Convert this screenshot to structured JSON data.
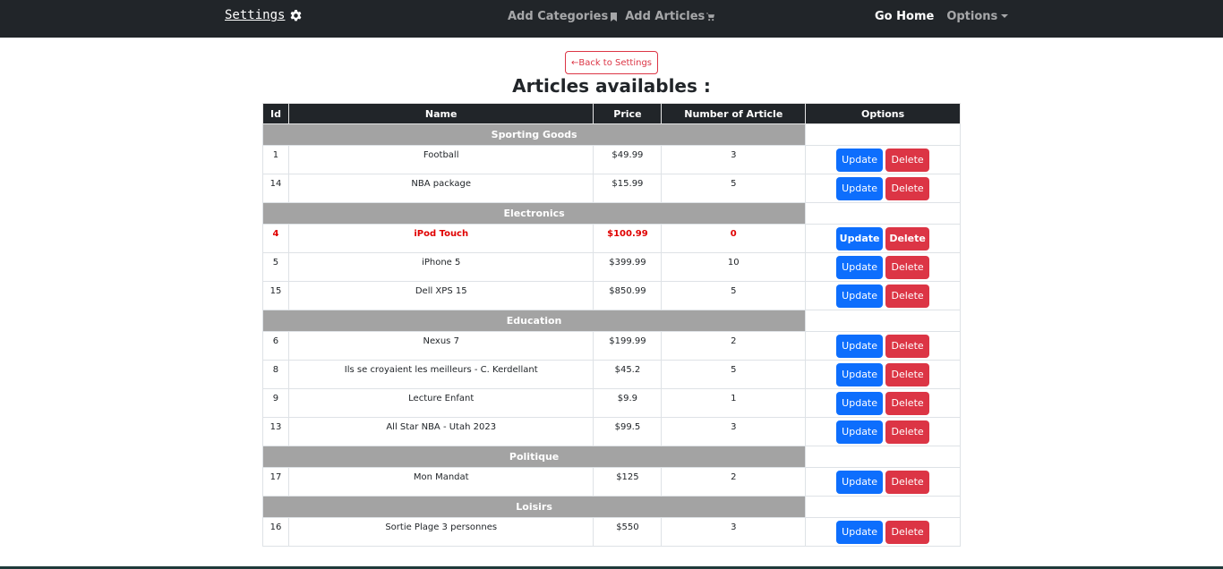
{
  "nav": {
    "brand": "Settings",
    "brand_icon": "gear-icon",
    "add_categories": "Add Categories",
    "add_categories_icon": "bookmark-icon",
    "add_articles": "Add Articles",
    "add_articles_icon": "cart-icon",
    "go_home": "Go Home",
    "options": "Options"
  },
  "back_button": "←Back to Settings",
  "title": "Articles availables :",
  "columns": [
    "Id",
    "Name",
    "Price",
    "Number of Article",
    "Options"
  ],
  "button_labels": {
    "update": "Update",
    "delete": "Delete"
  },
  "colors": {
    "navbar": "#212529",
    "update": "#0d6efd",
    "delete": "#dc3545",
    "category_row": "#a3a3a3",
    "out_of_stock": "#e00000"
  },
  "categories": [
    {
      "name": "Sporting Goods",
      "items": [
        {
          "id": "1",
          "name": "Football",
          "price": "$49.99",
          "count": "3"
        },
        {
          "id": "14",
          "name": "NBA package",
          "price": "$15.99",
          "count": "5"
        }
      ]
    },
    {
      "name": "Electronics",
      "items": [
        {
          "id": "4",
          "name": "iPod Touch",
          "price": "$100.99",
          "count": "0",
          "alert": true
        },
        {
          "id": "5",
          "name": "iPhone 5",
          "price": "$399.99",
          "count": "10"
        },
        {
          "id": "15",
          "name": "Dell XPS 15",
          "price": "$850.99",
          "count": "5"
        }
      ]
    },
    {
      "name": "Education",
      "items": [
        {
          "id": "6",
          "name": "Nexus 7",
          "price": "$199.99",
          "count": "2"
        },
        {
          "id": "8",
          "name": "Ils se croyaient les meilleurs - C. Kerdellant",
          "price": "$45.2",
          "count": "5"
        },
        {
          "id": "9",
          "name": "Lecture Enfant",
          "price": "$9.9",
          "count": "1"
        },
        {
          "id": "13",
          "name": "All Star NBA - Utah 2023",
          "price": "$99.5",
          "count": "3"
        }
      ]
    },
    {
      "name": "Politique",
      "items": [
        {
          "id": "17",
          "name": "Mon Mandat",
          "price": "$125",
          "count": "2"
        }
      ]
    },
    {
      "name": "Loisirs",
      "items": [
        {
          "id": "16",
          "name": "Sortie Plage 3 personnes",
          "price": "$550",
          "count": "3"
        }
      ]
    }
  ]
}
